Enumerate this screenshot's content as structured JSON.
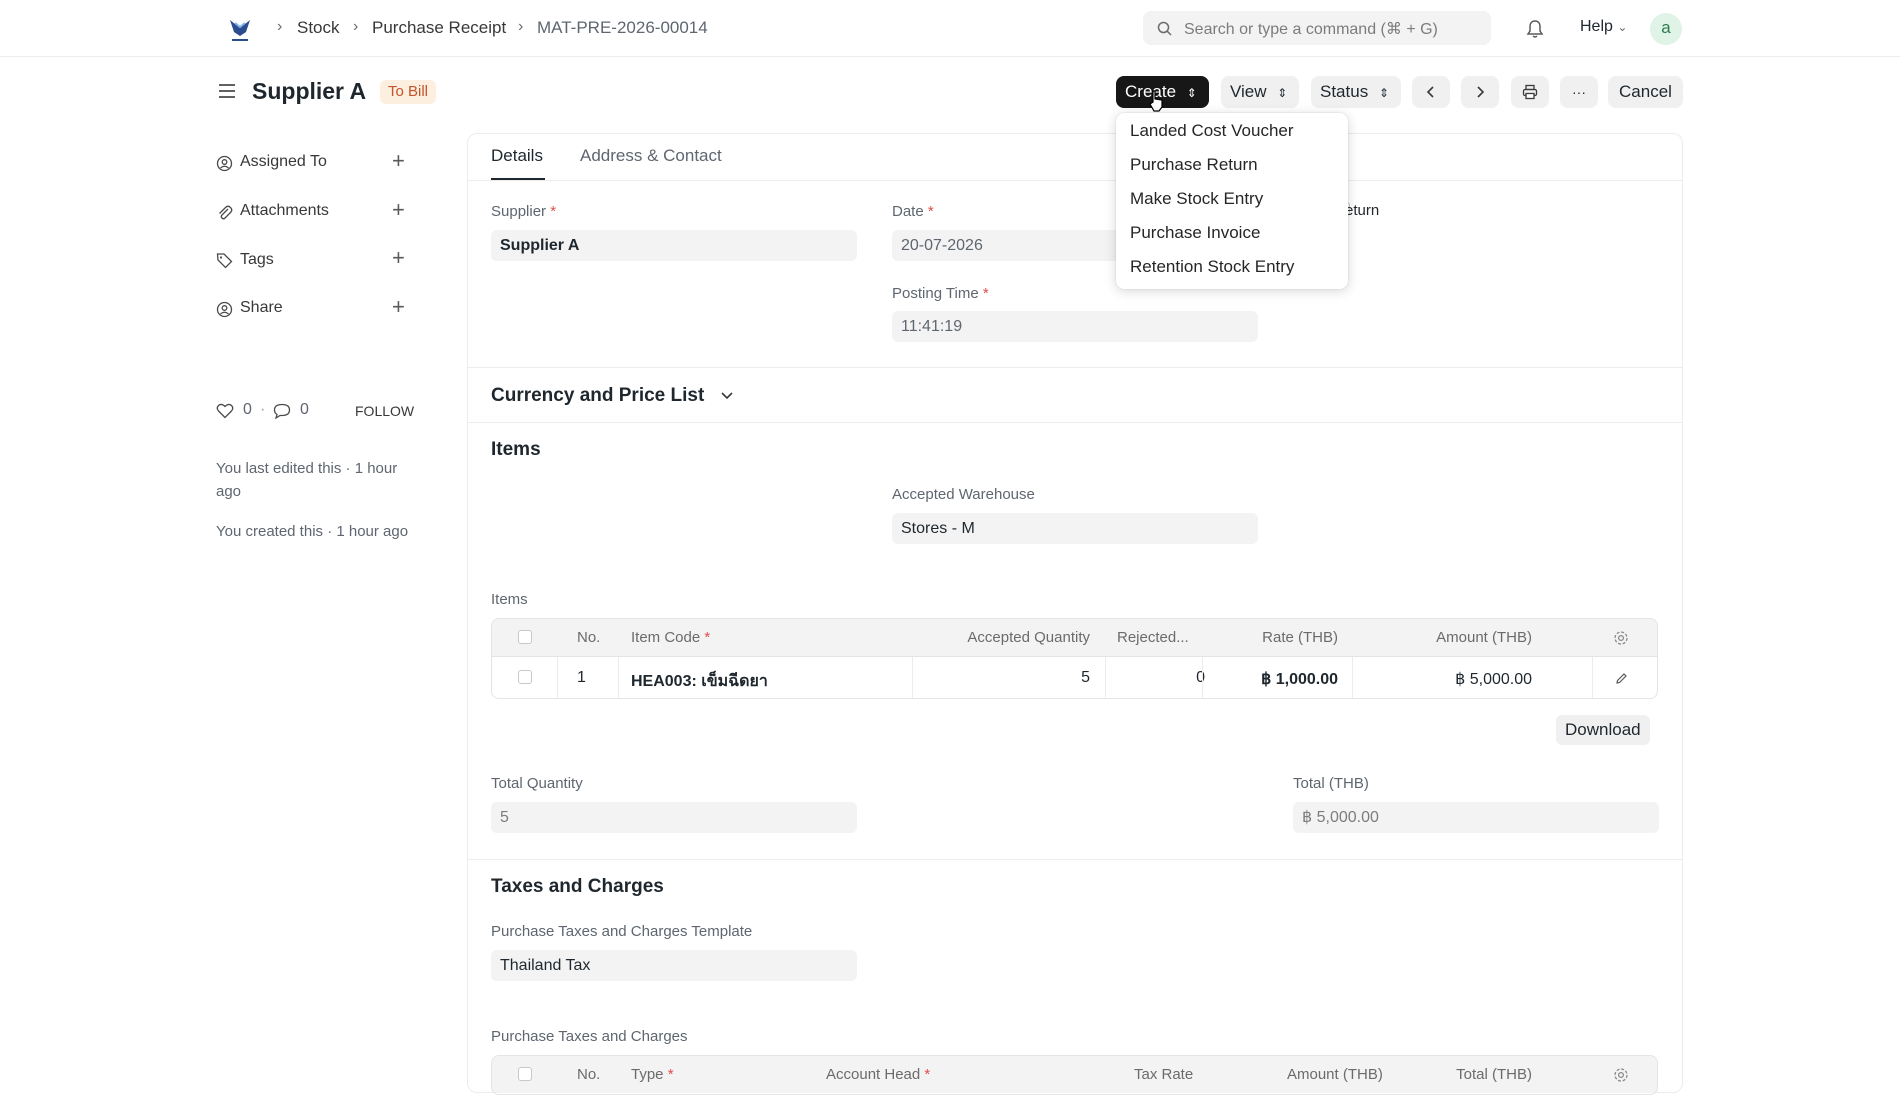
{
  "breadcrumb": {
    "items": [
      "Stock",
      "Purchase Receipt",
      "MAT-PRE-2026-00014"
    ]
  },
  "search": {
    "placeholder": "Search or type a command (⌘ + G)"
  },
  "topbar": {
    "help_label": "Help",
    "avatar_letter": "a"
  },
  "page": {
    "title": "Supplier A",
    "status": "To Bill"
  },
  "toolbar": {
    "create": "Create",
    "view": "View",
    "status": "Status",
    "cancel": "Cancel",
    "more": "···"
  },
  "create_menu": {
    "items": [
      "Landed Cost Voucher",
      "Purchase Return",
      "Make Stock Entry",
      "Purchase Invoice",
      "Retention Stock Entry"
    ]
  },
  "sidebar": {
    "assigned_to": "Assigned To",
    "attachments": "Attachments",
    "tags": "Tags",
    "share": "Share",
    "likes": "0",
    "comments": "0",
    "follow": "FOLLOW",
    "last_edited": "You last edited this · 1 hour ago",
    "created": "You created this · 1 hour ago"
  },
  "tabs": {
    "details": "Details",
    "address": "Address & Contact"
  },
  "form": {
    "supplier_label": "Supplier",
    "supplier_value": "Supplier A",
    "date_label": "Date",
    "date_value": "20-07-2026",
    "posting_time_label": "Posting Time",
    "posting_time_value": "11:41:19",
    "return_partial": "eturn",
    "currency_section": "Currency and Price List",
    "items_section": "Items",
    "accepted_wh_label": "Accepted Warehouse",
    "accepted_wh_value": "Stores - M",
    "items_table_label": "Items",
    "total_qty_label": "Total Quantity",
    "total_qty_value": "5",
    "total_label": "Total (THB)",
    "total_value": "฿ 5,000.00",
    "taxes_section": "Taxes and Charges",
    "tax_template_label": "Purchase Taxes and Charges Template",
    "tax_template_value": "Thailand Tax",
    "tax_table_label": "Purchase Taxes and Charges",
    "download": "Download"
  },
  "items_table": {
    "headers": {
      "no": "No.",
      "item_code": "Item Code",
      "accepted_qty": "Accepted Quantity",
      "rejected": "Rejected...",
      "rate": "Rate (THB)",
      "amount": "Amount (THB)"
    },
    "rows": [
      {
        "no": "1",
        "item_code": "HEA003: เข็มฉีดยา",
        "accepted_qty": "5",
        "rejected": "0",
        "rate": "฿ 1,000.00",
        "amount": "฿ 5,000.00"
      }
    ]
  },
  "tax_table": {
    "headers": {
      "no": "No.",
      "type": "Type",
      "account_head": "Account Head",
      "tax_rate": "Tax Rate",
      "amount": "Amount (THB)",
      "total": "Total (THB)"
    }
  }
}
